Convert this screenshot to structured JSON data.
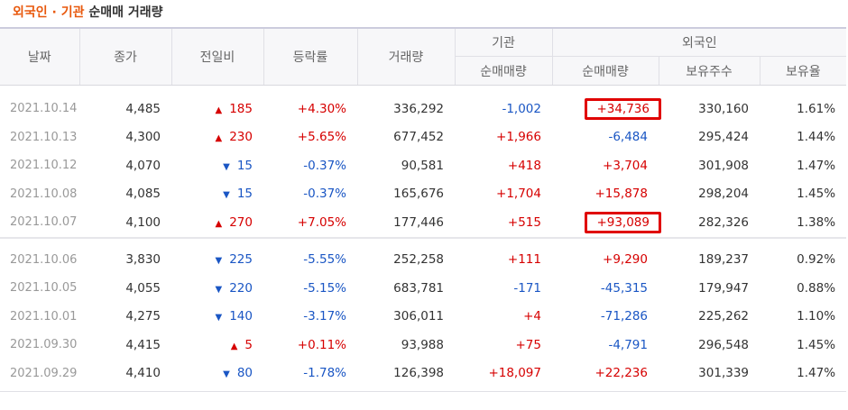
{
  "title": {
    "part1": "외국인 · 기관",
    "part2": "순매매 거래량"
  },
  "headers": {
    "date": "날짜",
    "close": "종가",
    "change": "전일비",
    "rate": "등락률",
    "volume": "거래량",
    "inst_group": "기관",
    "foreign_group": "외국인",
    "inst_net": "순매매량",
    "foreign_net": "순매매량",
    "foreign_hold": "보유주수",
    "foreign_ratio": "보유율"
  },
  "group1": [
    {
      "date": "2021.10.14",
      "close": "4,485",
      "dir": "up",
      "arrow": "▲",
      "change": "185",
      "rate": "+4.30%",
      "volume": "336,292",
      "inst": "-1,002",
      "foreign": "+34,736",
      "hold": "330,160",
      "ratio": "1.61%"
    },
    {
      "date": "2021.10.13",
      "close": "4,300",
      "dir": "up",
      "arrow": "▲",
      "change": "230",
      "rate": "+5.65%",
      "volume": "677,452",
      "inst": "+1,966",
      "foreign": "-6,484",
      "hold": "295,424",
      "ratio": "1.44%"
    },
    {
      "date": "2021.10.12",
      "close": "4,070",
      "dir": "down",
      "arrow": "▼",
      "change": "15",
      "rate": "-0.37%",
      "volume": "90,581",
      "inst": "+418",
      "foreign": "+3,704",
      "hold": "301,908",
      "ratio": "1.47%"
    },
    {
      "date": "2021.10.08",
      "close": "4,085",
      "dir": "down",
      "arrow": "▼",
      "change": "15",
      "rate": "-0.37%",
      "volume": "165,676",
      "inst": "+1,704",
      "foreign": "+15,878",
      "hold": "298,204",
      "ratio": "1.45%"
    },
    {
      "date": "2021.10.07",
      "close": "4,100",
      "dir": "up",
      "arrow": "▲",
      "change": "270",
      "rate": "+7.05%",
      "volume": "177,446",
      "inst": "+515",
      "foreign": "+93,089",
      "hold": "282,326",
      "ratio": "1.38%"
    }
  ],
  "group2": [
    {
      "date": "2021.10.06",
      "close": "3,830",
      "dir": "down",
      "arrow": "▼",
      "change": "225",
      "rate": "-5.55%",
      "volume": "252,258",
      "inst": "+111",
      "foreign": "+9,290",
      "hold": "189,237",
      "ratio": "0.92%"
    },
    {
      "date": "2021.10.05",
      "close": "4,055",
      "dir": "down",
      "arrow": "▼",
      "change": "220",
      "rate": "-5.15%",
      "volume": "683,781",
      "inst": "-171",
      "foreign": "-45,315",
      "hold": "179,947",
      "ratio": "0.88%"
    },
    {
      "date": "2021.10.01",
      "close": "4,275",
      "dir": "down",
      "arrow": "▼",
      "change": "140",
      "rate": "-3.17%",
      "volume": "306,011",
      "inst": "+4",
      "foreign": "-71,286",
      "hold": "225,262",
      "ratio": "1.10%"
    },
    {
      "date": "2021.09.30",
      "close": "4,415",
      "dir": "up",
      "arrow": "▲",
      "change": "5",
      "rate": "+0.11%",
      "volume": "93,988",
      "inst": "+75",
      "foreign": "-4,791",
      "hold": "296,548",
      "ratio": "1.45%"
    },
    {
      "date": "2021.09.29",
      "close": "4,410",
      "dir": "down",
      "arrow": "▼",
      "change": "80",
      "rate": "-1.78%",
      "volume": "126,398",
      "inst": "+18,097",
      "foreign": "+22,236",
      "hold": "301,339",
      "ratio": "1.47%"
    }
  ],
  "highlighted_cells": [
    "group1.0.foreign",
    "group1.4.foreign"
  ],
  "colors": {
    "up": "#d60000",
    "down": "#1a56c4",
    "title_accent": "#e8580c",
    "highlight_border": "#e00000"
  }
}
